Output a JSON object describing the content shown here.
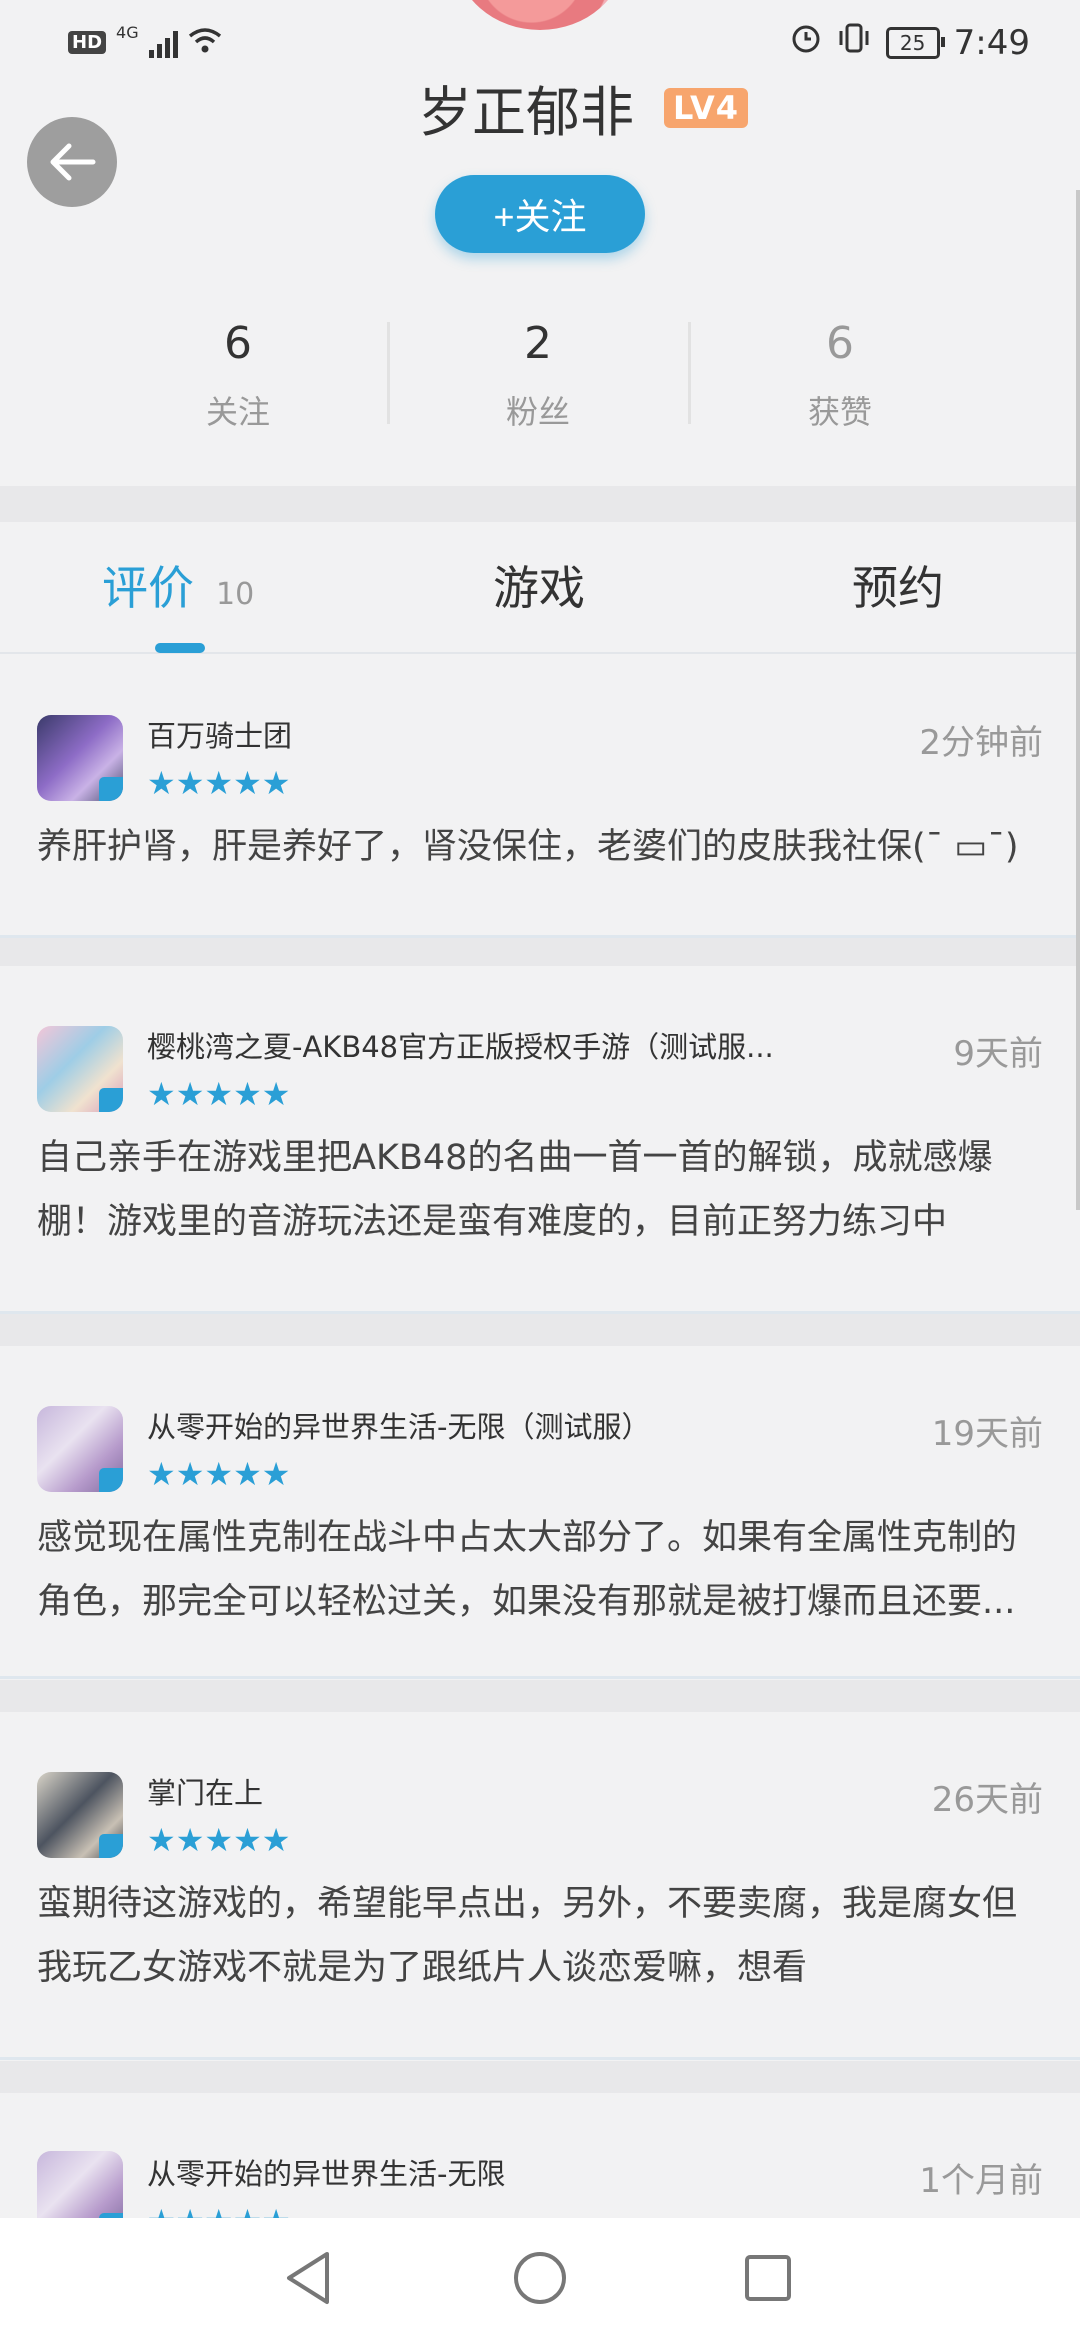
{
  "status_bar": {
    "hd": "HD",
    "network": "4G",
    "battery": "25",
    "time": "7:49"
  },
  "profile": {
    "username": "岁正郁非",
    "level": "LV4",
    "follow_label": "+关注"
  },
  "stats": [
    {
      "value": "6",
      "label": "关注"
    },
    {
      "value": "2",
      "label": "粉丝"
    },
    {
      "value": "6",
      "label": "获赞"
    }
  ],
  "tabs": [
    {
      "label": "评价",
      "count": "10"
    },
    {
      "label": "游戏"
    },
    {
      "label": "预约"
    }
  ],
  "reviews": [
    {
      "game": "百万骑士团",
      "stars": "★★★★★",
      "time": "2分钟前",
      "text": "养肝护肾，肝是养好了，肾没保住，老婆们的皮肤我社保(¯ ▭¯)"
    },
    {
      "game": "樱桃湾之夏-AKB48官方正版授权手游（测试服...",
      "stars": "★★★★★",
      "time": "9天前",
      "text": "自己亲手在游戏里把AKB48的名曲一首一首的解锁，成就感爆棚！游戏里的音游玩法还是蛮有难度的，目前正努力练习中"
    },
    {
      "game": "从零开始的异世界生活-无限（测试服）",
      "stars": "★★★★★",
      "time": "19天前",
      "text": "感觉现在属性克制在战斗中占太大部分了。如果有全属性克制的角色，那完全可以轻松过关，如果没有那就是被打爆而且还要..."
    },
    {
      "game": "掌门在上",
      "stars": "★★★★★",
      "time": "26天前",
      "text": "蛮期待这游戏的，希望能早点出，另外，不要卖腐，我是腐女但我玩乙女游戏不就是为了跟纸片人谈恋爱嘛，想看"
    },
    {
      "game": "从零开始的异世界生活-无限",
      "stars": "★★★★★",
      "time": "1个月前",
      "text": ""
    }
  ],
  "colors": {
    "accent": "#2a9fd6",
    "level_badge": "#f7a56d"
  }
}
